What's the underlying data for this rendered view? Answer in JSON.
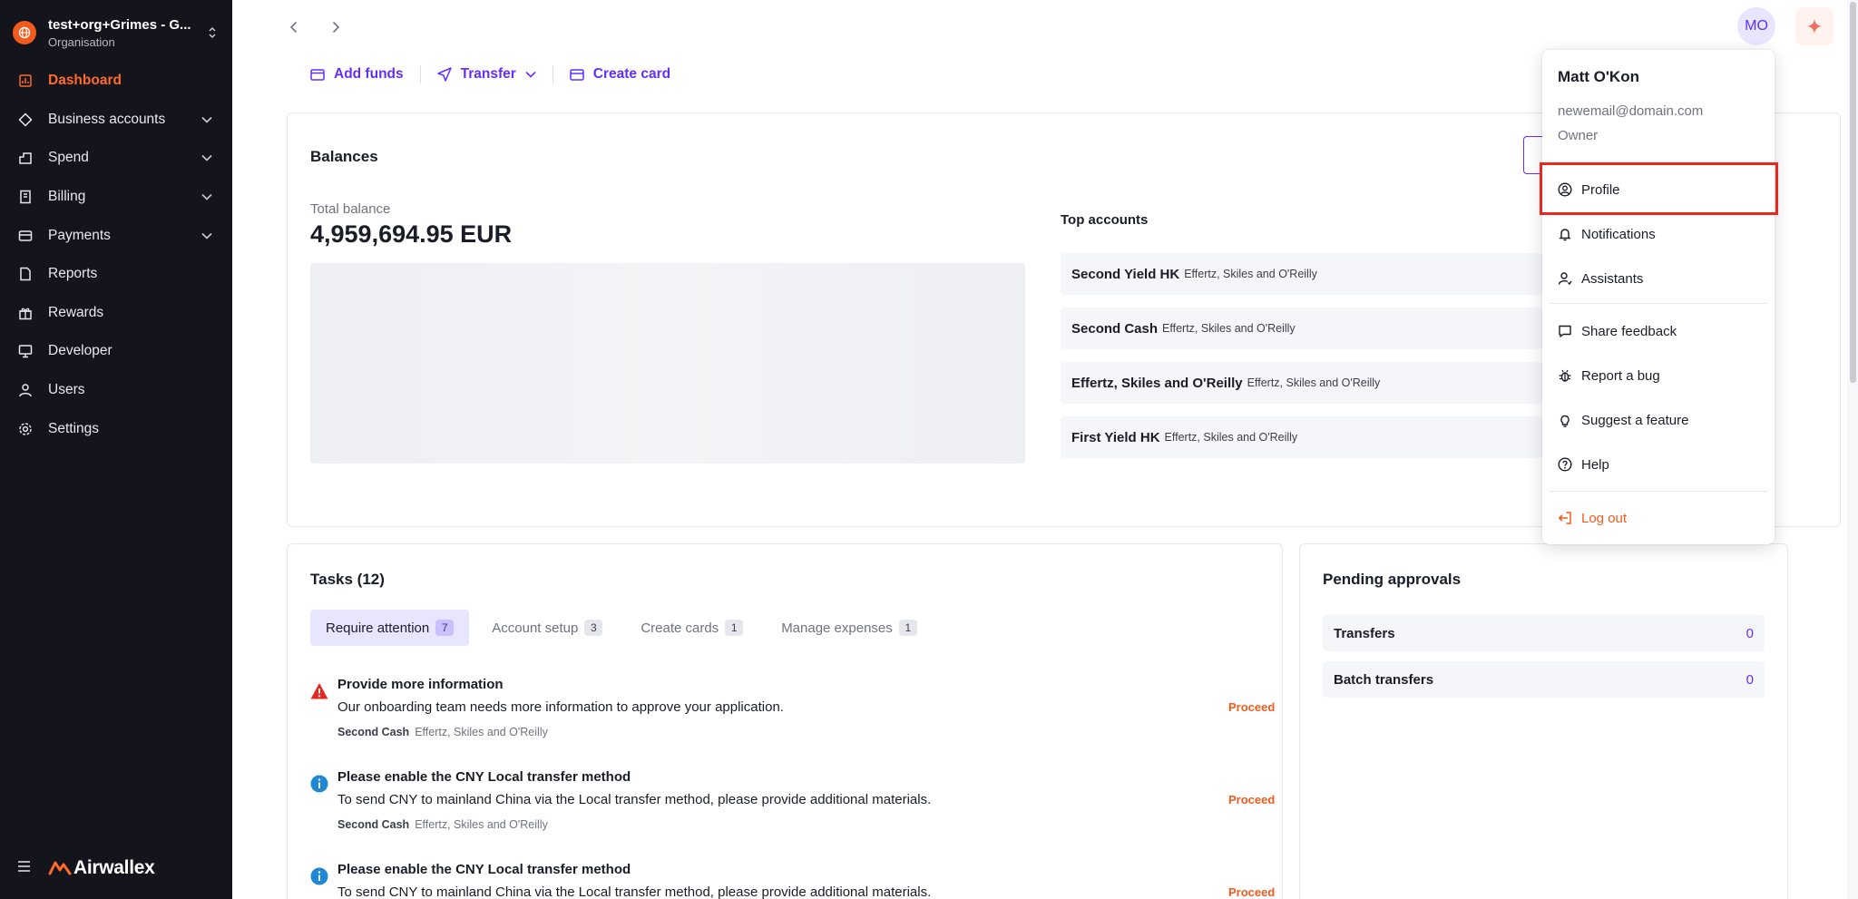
{
  "org": {
    "name": "test+org+Grimes - G...",
    "subtitle": "Organisation"
  },
  "nav": [
    {
      "label": "Dashboard",
      "icon": "chart-icon",
      "active": true
    },
    {
      "label": "Business accounts",
      "icon": "accounts-icon",
      "chevron": true
    },
    {
      "label": "Spend",
      "icon": "spend-icon",
      "chevron": true
    },
    {
      "label": "Billing",
      "icon": "billing-icon",
      "chevron": true
    },
    {
      "label": "Payments",
      "icon": "payments-icon",
      "chevron": true
    },
    {
      "label": "Reports",
      "icon": "reports-icon"
    },
    {
      "label": "Rewards",
      "icon": "gift-icon"
    },
    {
      "label": "Developer",
      "icon": "monitor-icon"
    },
    {
      "label": "Users",
      "icon": "user-icon"
    },
    {
      "label": "Settings",
      "icon": "gear-icon"
    }
  ],
  "brand": "Airwallex",
  "quick_actions": {
    "add_funds": "Add funds",
    "transfer": "Transfer",
    "create_card": "Create card"
  },
  "user": {
    "initials": "MO",
    "name": "Matt O'Kon",
    "email": "newemail@domain.com",
    "role": "Owner"
  },
  "balances": {
    "title": "Balances",
    "total_label": "Total balance",
    "total_value": "4,959,694.95 EUR",
    "top_accounts_title": "Top accounts",
    "accounts": [
      {
        "name": "Second Yield HK",
        "entity": "Effertz, Skiles and O'Reilly"
      },
      {
        "name": "Second Cash",
        "entity": "Effertz, Skiles and O'Reilly"
      },
      {
        "name": "Effertz, Skiles and O'Reilly",
        "entity": "Effertz, Skiles and O'Reilly"
      },
      {
        "name": "First Yield HK",
        "entity": "Effertz, Skiles and O'Reilly"
      }
    ]
  },
  "tasks": {
    "title": "Tasks (12)",
    "tabs": [
      {
        "label": "Require attention",
        "count": "7"
      },
      {
        "label": "Account setup",
        "count": "3"
      },
      {
        "label": "Create cards",
        "count": "1"
      },
      {
        "label": "Manage expenses",
        "count": "1"
      }
    ],
    "items": [
      {
        "type": "warning",
        "title": "Provide more information",
        "desc": "Our onboarding team needs more information to approve your application.",
        "account": "Second Cash",
        "entity": "Effertz, Skiles and O'Reilly",
        "action": "Proceed"
      },
      {
        "type": "info",
        "title": "Please enable the CNY Local transfer method",
        "desc": "To send CNY to mainland China via the Local transfer method, please provide additional materials.",
        "account": "Second Cash",
        "entity": "Effertz, Skiles and O'Reilly",
        "action": "Proceed"
      },
      {
        "type": "info",
        "title": "Please enable the CNY Local transfer method",
        "desc": "To send CNY to mainland China via the Local transfer method, please provide additional materials.",
        "account": "",
        "entity": "",
        "action": "Proceed"
      }
    ]
  },
  "approvals": {
    "title": "Pending approvals",
    "rows": [
      {
        "label": "Transfers",
        "count": "0"
      },
      {
        "label": "Batch transfers",
        "count": "0"
      }
    ]
  },
  "menu": {
    "items": [
      {
        "label": "Profile",
        "icon": "profile-icon"
      },
      {
        "label": "Notifications",
        "icon": "bell-icon"
      },
      {
        "label": "Assistants",
        "icon": "assistant-icon"
      },
      {
        "label": "Share feedback",
        "icon": "chat-icon"
      },
      {
        "label": "Report a bug",
        "icon": "bug-icon"
      },
      {
        "label": "Suggest a feature",
        "icon": "bulb-icon"
      },
      {
        "label": "Help",
        "icon": "help-icon"
      }
    ],
    "logout": "Log out"
  },
  "colors": {
    "accent": "#612fff",
    "brand": "#f25b1d",
    "sidebar_bg": "#14151c",
    "highlight": "#e8281f"
  }
}
